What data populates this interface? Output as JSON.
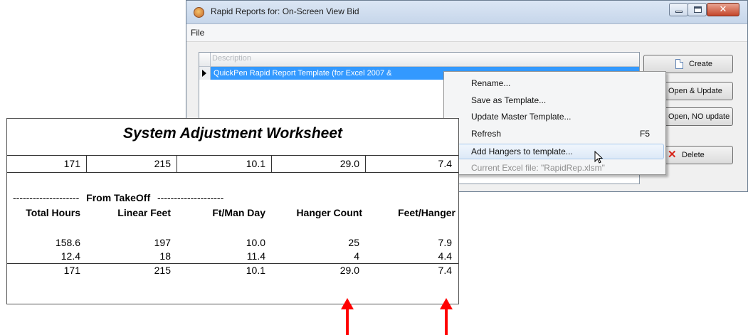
{
  "window": {
    "title": "Rapid Reports for: On-Screen View Bid",
    "menu": [
      "File"
    ],
    "grid": {
      "column_header": "Description",
      "rows": [
        "QuickPen Rapid Report Template (for Excel 2007 &"
      ]
    },
    "buttons": {
      "create": "Create",
      "open_update": "Open & Update",
      "open_no_update": "Open, NO update",
      "delete": "Delete"
    }
  },
  "context_menu": {
    "items": [
      {
        "label": "Rename...",
        "shortcut": ""
      },
      {
        "label": "Save as Template...",
        "shortcut": ""
      },
      {
        "label": "Update Master Template...",
        "shortcut": ""
      },
      {
        "label": "Refresh",
        "shortcut": "F5"
      },
      {
        "label": "Add Hangers to template...",
        "shortcut": ""
      },
      {
        "label": "Current Excel file: \"RapidRep.xlsm\"",
        "shortcut": ""
      }
    ]
  },
  "worksheet": {
    "title": "System Adjustment Worksheet",
    "summary_top": [
      "171",
      "215",
      "10.1",
      "29.0",
      "7.4"
    ],
    "section_label": "From TakeOff",
    "section_dashes": "--------------------",
    "headers": [
      "Total Hours",
      "Linear Feet",
      "Ft/Man Day",
      "Hanger Count",
      "Feet/Hanger"
    ],
    "rows": [
      [
        "158.6",
        "197",
        "10.0",
        "25",
        "7.9"
      ],
      [
        "12.4",
        "18",
        "11.4",
        "4",
        "4.4"
      ]
    ],
    "totals": [
      "171",
      "215",
      "10.1",
      "29.0",
      "7.4"
    ]
  },
  "colors": {
    "selection": "#3399ff",
    "arrow": "#ff0000"
  }
}
